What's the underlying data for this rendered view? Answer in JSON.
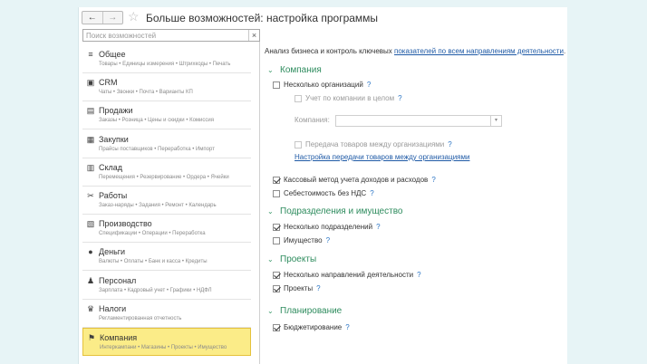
{
  "window": {
    "title": "Больше возможностей: настройка программы",
    "back_icon": "←",
    "forward_icon": "→",
    "favorite_icon": "☆"
  },
  "search": {
    "placeholder": "Поиск возможностей",
    "clear_icon": "×"
  },
  "sidebar": {
    "sections": [
      {
        "title": "Общее",
        "subtitle": "Товары • Единицы измерения • Штрихкоды • Печать",
        "icon": "≡",
        "icon_name": "list-icon"
      },
      {
        "title": "CRM",
        "subtitle": "Чаты • Звонки • Почта • Варианты КП",
        "icon": "▣",
        "icon_name": "crm-icon"
      },
      {
        "title": "Продажи",
        "subtitle": "Заказы • Розница • Цены и скидки • Комиссия",
        "icon": "▤",
        "icon_name": "sales-icon"
      },
      {
        "title": "Закупки",
        "subtitle": "Прайсы поставщиков • Переработка • Импорт",
        "icon": "▦",
        "icon_name": "purchases-icon"
      },
      {
        "title": "Склад",
        "subtitle": "Перемещения • Резервирование • Ордера • Ячейки",
        "icon": "▥",
        "icon_name": "warehouse-icon"
      },
      {
        "title": "Работы",
        "subtitle": "Заказ-наряды • Задания • Ремонт • Календарь",
        "icon": "✂",
        "icon_name": "tools-icon"
      },
      {
        "title": "Производство",
        "subtitle": "Спецификации • Операции • Переработка",
        "icon": "▧",
        "icon_name": "production-icon"
      },
      {
        "title": "Деньги",
        "subtitle": "Валюты • Оплаты • Банк и касса • Кредиты",
        "icon": "●",
        "icon_name": "money-icon"
      },
      {
        "title": "Персонал",
        "subtitle": "Зарплата • Кадровый учет • Графики • НДФЛ",
        "icon": "♟",
        "icon_name": "personnel-icon"
      },
      {
        "title": "Налоги",
        "subtitle": "Регламентированная отчетность",
        "icon": "♛",
        "icon_name": "taxes-icon"
      },
      {
        "title": "Компания",
        "subtitle": "Интеркампани • Магазины • Проекты • Имущество",
        "icon": "⚑",
        "icon_name": "flag-icon"
      }
    ]
  },
  "content": {
    "intro_text": "Анализ бизнеса и контроль ключевых ",
    "intro_link": "показателей по всем направлениям деятельности",
    "intro_end": ".",
    "groups": {
      "company": "Компания",
      "divisions": "Подразделения и имущество",
      "projects": "Проекты",
      "planning": "Планирование"
    },
    "options": {
      "several_orgs": "Несколько организаций",
      "company_accounting": "Учет по компании в целом",
      "company_label": "Компания:",
      "transfer_goods": "Передача товаров между организациями",
      "transfer_settings_link": "Настройка передачи товаров между организациями",
      "cash_method": "Кассовый метод учета доходов и расходов",
      "cost_no_vat": "Себестоимость без НДС",
      "several_divisions": "Несколько подразделений",
      "property": "Имущество",
      "several_directions": "Несколько направлений деятельности",
      "projects": "Проекты",
      "budgeting": "Бюджетирование"
    },
    "help_icon": "?",
    "collapse_icon": "⌄",
    "dropdown_icon": "▾"
  }
}
